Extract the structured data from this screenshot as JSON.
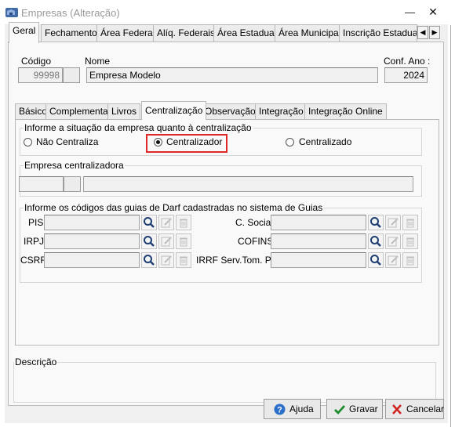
{
  "window": {
    "title": "Empresas (Alteração)",
    "minimize_glyph": "—",
    "close_glyph": "✕"
  },
  "top_tabs": [
    "Geral",
    "Fechamento",
    "Área Federal",
    "Alíq. Federais",
    "Área Estadual",
    "Área Municipal",
    "Inscrição Estadual S"
  ],
  "top_tabs_active": "Geral",
  "header": {
    "codigo_label": "Código",
    "codigo_value": "99998",
    "nome_label": "Nome",
    "nome_value": "Empresa Modelo",
    "conf_ano_label": "Conf. Ano :",
    "conf_ano_value": "2024"
  },
  "inner_tabs": [
    "Básico",
    "Complementar",
    "Livros",
    "Centralização",
    "Observação",
    "Integração",
    "Integração Online"
  ],
  "inner_tabs_active": "Centralização",
  "centralizacao": {
    "group_title": "Informe a situação da empresa quanto à centralização",
    "options": [
      "Não Centraliza",
      "Centralizador",
      "Centralizado"
    ],
    "selected": "Centralizador"
  },
  "empresa_centralizadora": {
    "group_title": "Empresa centralizadora",
    "code_value": "",
    "name_value": ""
  },
  "guias": {
    "group_title": "Informe os códigos das guias de Darf cadastradas no sistema de Guias",
    "left_labels": [
      "PIS",
      "IRPJ",
      "CSRF"
    ],
    "right_labels": [
      "C. Social",
      "COFINS",
      "IRRF Serv.Tom. PJ"
    ]
  },
  "descricao": {
    "group_title": "Descrição"
  },
  "buttons": {
    "ajuda": "Ajuda",
    "gravar": "Gravar",
    "cancelar": "Cancelar"
  },
  "colors": {
    "highlight": "#e0282b",
    "gravar_check": "#1e8c2e",
    "cancelar_x": "#d0201c",
    "ajuda_icon": "#2a6fc9"
  },
  "icons": [
    "app-icon",
    "scroll-left-icon",
    "scroll-right-icon",
    "search-icon",
    "edit-icon",
    "trash-icon",
    "help-icon",
    "check-icon",
    "cancel-x-icon"
  ]
}
